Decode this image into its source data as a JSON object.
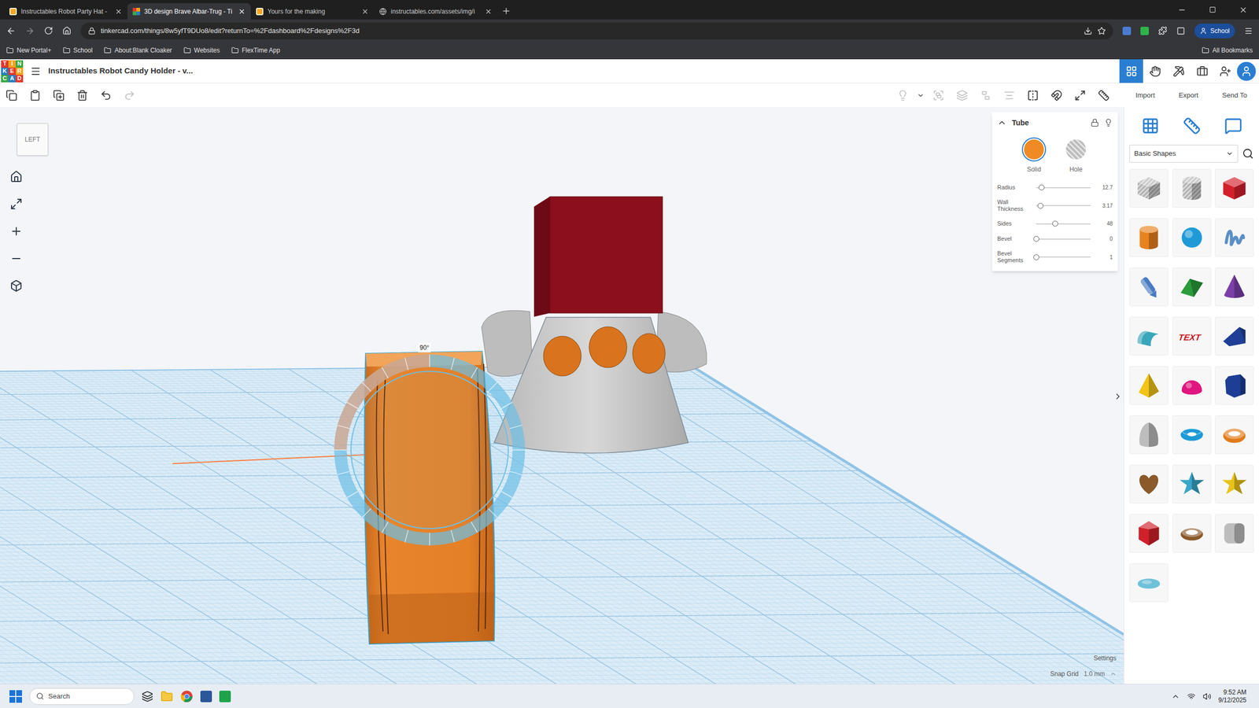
{
  "browser": {
    "tabs": [
      {
        "label": "Instructables Robot Party Hat -",
        "selected": false,
        "kind": "instructables"
      },
      {
        "label": "3D design Brave Albar-Trug - Ti",
        "selected": true,
        "kind": "tinkercad"
      },
      {
        "label": "Yours for the making",
        "selected": false,
        "kind": "instructables"
      },
      {
        "label": "instructables.com/assets/img/i",
        "selected": false,
        "kind": "globe"
      }
    ],
    "address": "tinkercad.com/things/8w5yfT9DUo8/edit?returnTo=%2Fdashboard%2Fdesigns%2F3d",
    "profile": "School",
    "bookmarks": [
      "New Portal+",
      "School",
      "About:Blank Cloaker",
      "Websites",
      "FlexTime App"
    ],
    "all_bookmarks": "All Bookmarks"
  },
  "app": {
    "logo": [
      "T",
      "I",
      "N",
      "K",
      "E",
      "R",
      "C",
      "A",
      "D"
    ],
    "design_title": "Instructables Robot Candy Holder - v...",
    "view_modes": [
      {
        "kind": "grid",
        "selected": true
      },
      {
        "kind": "hand",
        "selected": false
      },
      {
        "kind": "pickaxe",
        "selected": false
      },
      {
        "kind": "briefcase",
        "selected": false
      }
    ],
    "actions": [
      "Import",
      "Export",
      "Send To"
    ]
  },
  "edit_tools": [
    {
      "kind": "copy",
      "disabled": false
    },
    {
      "kind": "paste",
      "disabled": false
    },
    {
      "kind": "duplicate",
      "disabled": false
    },
    {
      "kind": "delete",
      "disabled": false
    },
    {
      "kind": "undo",
      "disabled": false
    },
    {
      "kind": "redo",
      "disabled": true
    }
  ],
  "shape_tools": [
    {
      "kind": "light",
      "disabled": true
    },
    {
      "kind": "caret",
      "disabled": false
    },
    {
      "kind": "group",
      "disabled": true
    },
    {
      "kind": "union",
      "disabled": true
    },
    {
      "kind": "ungroup",
      "disabled": true
    },
    {
      "kind": "align",
      "disabled": true
    },
    {
      "kind": "mirror",
      "disabled": false
    },
    {
      "kind": "magnet",
      "disabled": false
    },
    {
      "kind": "workplane",
      "disabled": false
    },
    {
      "kind": "ruler",
      "disabled": false
    }
  ],
  "view_cube": "LEFT",
  "rotation_label": "90°",
  "inspector": {
    "title": "Tube",
    "modes": [
      {
        "label": "Solid",
        "selected": true
      },
      {
        "label": "Hole",
        "selected": false
      }
    ],
    "params": [
      {
        "label": "Radius",
        "value": "12.7",
        "level": 0.1
      },
      {
        "label": "Wall Thickness",
        "value": "3.17",
        "level": 0.08
      },
      {
        "label": "Sides",
        "value": "48",
        "level": 0.35
      },
      {
        "label": "Bevel",
        "value": "0",
        "level": 0
      },
      {
        "label": "Bevel Segments",
        "value": "1",
        "level": 0
      }
    ]
  },
  "shapes_panel": {
    "category": "Basic Shapes",
    "shapes": [
      {
        "kind": "holebox",
        "color": "#b4b4b4"
      },
      {
        "kind": "holecyl",
        "color": "#b4b4b4"
      },
      {
        "kind": "box",
        "color": "#d4202c"
      },
      {
        "kind": "cylinder",
        "color": "#e8821e"
      },
      {
        "kind": "sphere",
        "color": "#1e9bd7"
      },
      {
        "kind": "scribble",
        "color": "#5b8fc7"
      },
      {
        "kind": "pen",
        "color": "#4a7bc0"
      },
      {
        "kind": "roof",
        "color": "#2a9d3a"
      },
      {
        "kind": "cone",
        "color": "#7b3fa8"
      },
      {
        "kind": "roundroof",
        "color": "#3aa6b9"
      },
      {
        "kind": "text",
        "color": "#c4151c",
        "label": "TEXT"
      },
      {
        "kind": "wedge",
        "color": "#1e3f95"
      },
      {
        "kind": "pyramid",
        "color": "#f2c418"
      },
      {
        "kind": "halfsphere",
        "color": "#e0157f"
      },
      {
        "kind": "polygon",
        "color": "#1d3e94"
      },
      {
        "kind": "paraboloid",
        "color": "#bdbdbd"
      },
      {
        "kind": "torus",
        "color": "#1d9ad6"
      },
      {
        "kind": "tube",
        "color": "#e07b1a"
      },
      {
        "kind": "heart",
        "color": "#8a5a2b"
      },
      {
        "kind": "star",
        "color": "#3aa6c9"
      },
      {
        "kind": "star",
        "color": "#e8c21a"
      },
      {
        "kind": "icosahedron",
        "color": "#d0202a"
      },
      {
        "kind": "ring",
        "color": "#8a5a2b"
      },
      {
        "kind": "rounded",
        "color": "#bdbdbd"
      },
      {
        "kind": "ellipsoid",
        "color": "#6fc1d9"
      }
    ]
  },
  "footer": {
    "settings": "Settings",
    "snap_label": "Snap Grid",
    "snap_value": "1.0 mm"
  },
  "taskbar": {
    "search": "Search",
    "time": "9:52 AM",
    "date": "9/12/2025"
  }
}
